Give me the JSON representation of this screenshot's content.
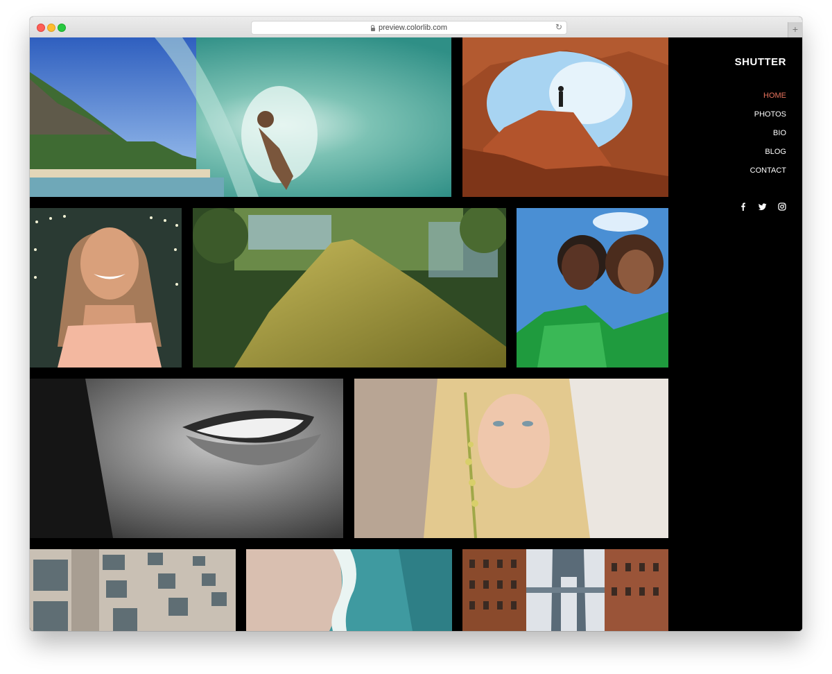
{
  "browser": {
    "url": "preview.colorlib.com",
    "reload_glyph": "↻",
    "newtab_glyph": "+"
  },
  "site": {
    "brand": "SHUTTER",
    "nav": [
      {
        "label": "HOME",
        "active": true
      },
      {
        "label": "PHOTOS",
        "active": false
      },
      {
        "label": "BIO",
        "active": false
      },
      {
        "label": "BLOG",
        "active": false
      },
      {
        "label": "CONTACT",
        "active": false
      }
    ],
    "social_icons": [
      "facebook-icon",
      "twitter-icon",
      "instagram-icon"
    ],
    "accent_color": "#e8735d"
  },
  "gallery": [
    {
      "name": "surfer-wave-photo"
    },
    {
      "name": "rock-arch-photo"
    },
    {
      "name": "smiling-woman-photo"
    },
    {
      "name": "moss-tree-photo"
    },
    {
      "name": "two-women-photo"
    },
    {
      "name": "smile-bw-photo"
    },
    {
      "name": "blonde-woman-photo"
    },
    {
      "name": "building-facade-photo"
    },
    {
      "name": "ocean-shore-photo"
    },
    {
      "name": "manhattan-bridge-photo"
    }
  ]
}
